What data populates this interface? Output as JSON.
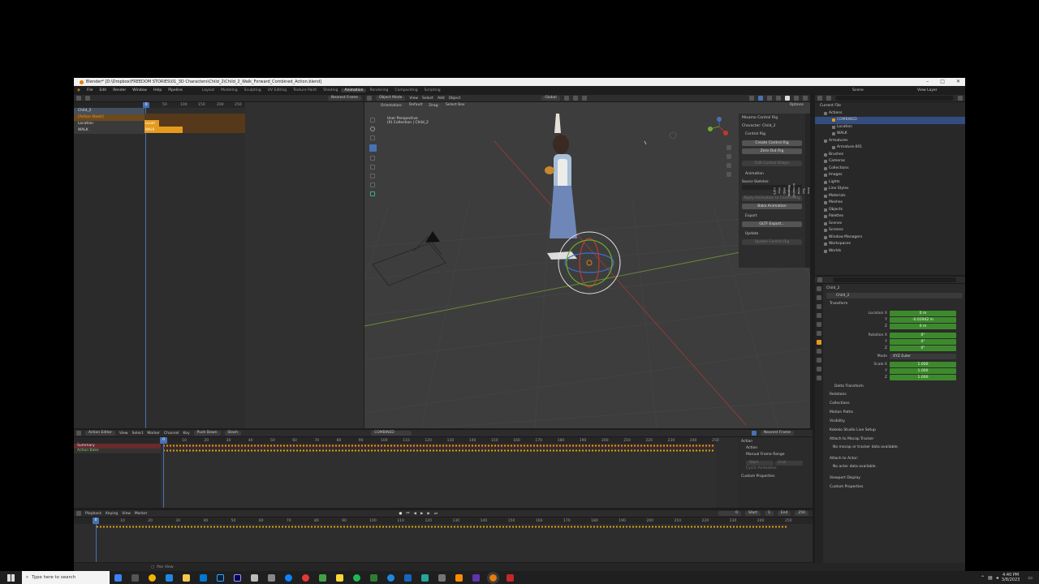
{
  "window": {
    "title": "Blender* [D:\\Dropbox\\FREEDOM STORIES\\01_3D Characters\\Child_2\\Child_2_Walk_Forward_Combined_Action.blend]"
  },
  "menu": [
    "File",
    "Edit",
    "Render",
    "Window",
    "Help",
    "Pipeline"
  ],
  "workspaces": [
    "Layout",
    "Modeling",
    "Sculpting",
    "UV Editing",
    "Texture Paint",
    "Shading",
    "Animation",
    "Rendering",
    "Compositing",
    "Scripting"
  ],
  "scene_label": "Scene",
  "view_layer_label": "View Layer",
  "nla": {
    "snap": "Nearest Frame",
    "ticks": [
      "0",
      "50",
      "100",
      "150",
      "200",
      "250"
    ],
    "current_frame": "0",
    "tracks": [
      {
        "name": "Child_2"
      },
      {
        "name": "[Action Stash]"
      },
      {
        "name": "Location"
      },
      {
        "name": "WALK"
      }
    ],
    "strips": [
      "Locati",
      "WALK"
    ]
  },
  "viewport": {
    "mode": "Object Mode",
    "menus": [
      "View",
      "Select",
      "Add",
      "Object"
    ],
    "orientation_label": "Orientation:",
    "orientation": "Default",
    "drag_label": "Drag:",
    "drag": "Select Box",
    "transform": "Global",
    "options": "Options",
    "title": "User Perspective",
    "collection": "(0) Collection | Child_2"
  },
  "mixamo": {
    "header": "Mixamo Control Rig",
    "character": "Character: Child_2",
    "control_rig": "Control Rig",
    "create": "Create Control Rig",
    "zero": "Zero Out Rig",
    "edit": "Edit Control Shape",
    "animation": "Animation",
    "source": "Source Skeleton:",
    "apply": "Apply Animation to Control Rig",
    "bake": "Bake Animation",
    "export": "Export",
    "gltf": "GLTF Export...",
    "update": "Update",
    "update_btn": "Update Control Rig"
  },
  "tabs": [
    "Item",
    "Tool",
    "View",
    "Animation",
    "Mixamo",
    "MMD",
    "Misc",
    "CATS"
  ],
  "outliner": {
    "title": "Current File",
    "rows": [
      "Actions",
      "COMBINED",
      "Location",
      "WALK",
      "Armatures",
      "Armature.001",
      "Brushes",
      "Cameras",
      "Collections",
      "Images",
      "Lights",
      "Line Styles",
      "Materials",
      "Meshes",
      "Objects",
      "Palettes",
      "Scenes",
      "Screens",
      "Window Managers",
      "Workspaces",
      "Worlds"
    ]
  },
  "properties": {
    "object": "Child_2",
    "name": "Child_2",
    "transform": "Transform",
    "location_x_label": "Location X",
    "y": "Y",
    "z": "Z",
    "location": [
      "0 m",
      "-0.02942 m",
      "0 m"
    ],
    "rotation_x_label": "Rotation X",
    "rotation": [
      "0°",
      "0°",
      "0°"
    ],
    "mode_label": "Mode",
    "mode": "XYZ Euler",
    "scale_x_label": "Scale X",
    "scale": [
      "1.000",
      "1.000",
      "1.000"
    ],
    "delta": "Delta Transform",
    "relations": "Relations",
    "collections": "Collections",
    "motion_paths": "Motion Paths",
    "visibility": "Visibility",
    "kokeko": "Kokeko Studio Live Setup",
    "attach_tracker": "Attach to Mocap Tracker",
    "no_tracker": "No mocap or tracker data available.",
    "attach_actor": "Attach to Actor:",
    "no_actor": "No actor data available.",
    "viewport_display": "Viewport Display",
    "custom_props": "Custom Properties"
  },
  "action_editor": {
    "mode": "Action Editor",
    "menus": [
      "View",
      "Select",
      "Marker",
      "Channel",
      "Key"
    ],
    "push_down": "Push Down",
    "stash": "Stash",
    "action": "COMBINED",
    "snap": "Nearest Frame",
    "ticks": [
      "0",
      "10",
      "20",
      "30",
      "40",
      "50",
      "60",
      "70",
      "80",
      "90",
      "100",
      "110",
      "120",
      "130",
      "140",
      "150",
      "160",
      "170",
      "180",
      "190",
      "200",
      "210",
      "220",
      "230",
      "240",
      "250"
    ],
    "channels": [
      "Summary",
      "Action Bake"
    ],
    "side": {
      "action": "Action",
      "action_sub": "Action",
      "manual": "Manual Frame Range",
      "start": "Start",
      "end": "End",
      "cyclic": "Cyclic Animation",
      "custom": "Custom Properties"
    }
  },
  "timeline": {
    "menus": [
      "Playback",
      "Keying",
      "View",
      "Marker"
    ],
    "frame": "0",
    "start_label": "Start",
    "start": "1",
    "end_label": "End",
    "end": "250",
    "ticks": [
      "0",
      "10",
      "20",
      "30",
      "40",
      "50",
      "60",
      "70",
      "80",
      "90",
      "100",
      "110",
      "120",
      "130",
      "140",
      "150",
      "160",
      "170",
      "180",
      "190",
      "200",
      "210",
      "220",
      "230",
      "240",
      "250"
    ]
  },
  "statusbar": {
    "text": "Pan View"
  },
  "taskbar": {
    "search": "Type here to search",
    "time": "4:40 PM",
    "date": "3/8/2023"
  },
  "colors": {
    "accent": "#e59a1d",
    "select": "#4772b3",
    "green_field": "#3d8a2d"
  }
}
